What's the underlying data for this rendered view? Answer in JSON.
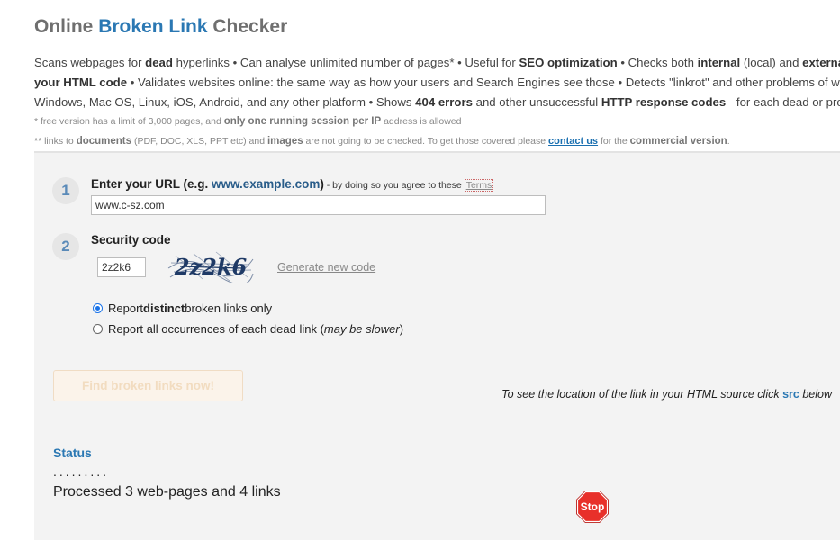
{
  "header": {
    "title_part1": "Online ",
    "title_accent": "Broken Link",
    "title_part2": " Checker"
  },
  "description": {
    "line1": [
      {
        "t": "Scans webpages for ",
        "b": false
      },
      {
        "t": "dead",
        "b": true
      },
      {
        "t": " hyperlinks • Can analyse unlimited number of pages* • Useful for ",
        "b": false
      },
      {
        "t": "SEO optimization",
        "b": true
      },
      {
        "t": " • Checks both ",
        "b": false
      },
      {
        "t": "internal",
        "b": true
      },
      {
        "t": " (local) and ",
        "b": false
      },
      {
        "t": "external",
        "b": true
      }
    ],
    "line2": [
      {
        "t": "your HTML code",
        "b": true
      },
      {
        "t": " • Validates websites online: the same way as how your users and Search Engines see those • Detects \"linkrot\" and other problems of web",
        "b": false
      }
    ],
    "line3": [
      {
        "t": "Windows, Mac OS, Linux, iOS, Android, and any other platform • Shows ",
        "b": false
      },
      {
        "t": "404 errors",
        "b": true
      },
      {
        "t": " and other unsuccessful ",
        "b": false
      },
      {
        "t": "HTTP response codes",
        "b": true
      },
      {
        "t": " - for each dead or probl",
        "b": false
      }
    ]
  },
  "notes": {
    "note1_prefix": "*  free version has a limit of 3,000 pages, and ",
    "note1_bold": "only one running session per IP",
    "note1_suffix": " address is allowed",
    "note2_a": "** links to ",
    "note2_b": "documents",
    "note2_c": " (PDF, DOC, XLS, PPT etc) and ",
    "note2_d": "images",
    "note2_e": " are not going to be checked. To get those covered please ",
    "note2_link": "contact us",
    "note2_f": " for the ",
    "note2_g": "commercial version",
    "note2_h": "."
  },
  "form": {
    "step1_number": "1",
    "step1_label": "Enter your URL (e.g. ",
    "step1_example": "www.example.com",
    "step1_close": ")",
    "step1_small": " - by doing so you agree to these ",
    "terms_link": "Terms",
    "url_value": "www.c-sz.com",
    "step2_number": "2",
    "step2_label": "Security code",
    "code_value": "2z2k6",
    "captcha_text": "2z2k6",
    "generate_link": "Generate new code",
    "radio1_pre": "Report ",
    "radio1_bold": "distinct",
    "radio1_post": " broken links only",
    "radio2_pre": "Report all occurrences of each dead link (",
    "radio2_italic": "may be slower",
    "radio2_post": ")",
    "radio_selected": 1
  },
  "results": {
    "find_button": "Find broken links now!",
    "src_hint_pre": "To see the location of the link in your HTML source click ",
    "src_hint_bold": "src",
    "src_hint_post": " below",
    "status_title": "Status",
    "dots": ".........",
    "processed_text": "Processed 3 web-pages and 4 links",
    "stop_label": "Stop"
  },
  "colors": {
    "accent": "#2b78b3",
    "stop_red": "#e8302a",
    "panel_bg": "#f3f3f3"
  }
}
